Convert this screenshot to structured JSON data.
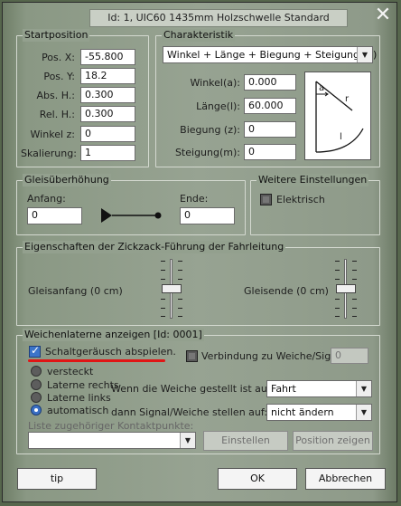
{
  "window": {
    "title": "Id: 1, UIC60 1435mm Holzschwelle Standard"
  },
  "startposition": {
    "title": "Startposition",
    "fields": [
      {
        "label": "Pos. X:",
        "value": "-55.800"
      },
      {
        "label": "Pos. Y:",
        "value": "18.2"
      },
      {
        "label": "Abs. H.:",
        "value": "0.300"
      },
      {
        "label": "Rel. H.:",
        "value": "0.300"
      },
      {
        "label": "Winkel z:",
        "value": "0"
      },
      {
        "label": "Skalierung:",
        "value": "1"
      }
    ]
  },
  "charakteristik": {
    "title": "Charakteristik",
    "selected": "Winkel + Länge + Biegung + Steigung(m)",
    "fields": [
      {
        "label": "Winkel(a):",
        "value": "0.000"
      },
      {
        "label": "Länge(l):",
        "value": "60.000"
      },
      {
        "label": "Biegung (z):",
        "value": "0"
      },
      {
        "label": "Steigung(m):",
        "value": "0"
      }
    ],
    "diagram": {
      "a": "a",
      "r": "r",
      "l": "l"
    }
  },
  "gleis": {
    "title": "Gleisüberhöhung",
    "anfang_label": "Anfang:",
    "anfang_value": "0",
    "ende_label": "Ende:",
    "ende_value": "0"
  },
  "weitere": {
    "title": "Weitere Einstellungen",
    "elektrisch": "Elektrisch"
  },
  "zickzack": {
    "title": "Eigenschaften der Zickzack-Führung der Fahrleitung",
    "left_label": "Gleisanfang (0 cm)",
    "right_label": "Gleisende (0 cm)"
  },
  "weichen": {
    "title": "Weichenlaterne anzeigen [Id: 0001]",
    "schalt": "Schaltgeräusch abspielen.",
    "verbindung": "Verbindung zu Weiche/Signal",
    "verbindung_value": "0",
    "radios": [
      "versteckt",
      "Laterne rechts",
      "Laterne links",
      "automatisch"
    ],
    "wenn_label": "Wenn die Weiche gestellt ist auf:",
    "wenn_value": "Fahrt",
    "dann_label": "dann Signal/Weiche stellen auf:",
    "dann_value": "nicht ändern",
    "kontakt_label": "Liste zugehöriger Kontaktpunkte:",
    "einstellen": "Einstellen",
    "position": "Position zeigen"
  },
  "buttons": {
    "tip": "tip",
    "ok": "OK",
    "abbrechen": "Abbrechen"
  }
}
